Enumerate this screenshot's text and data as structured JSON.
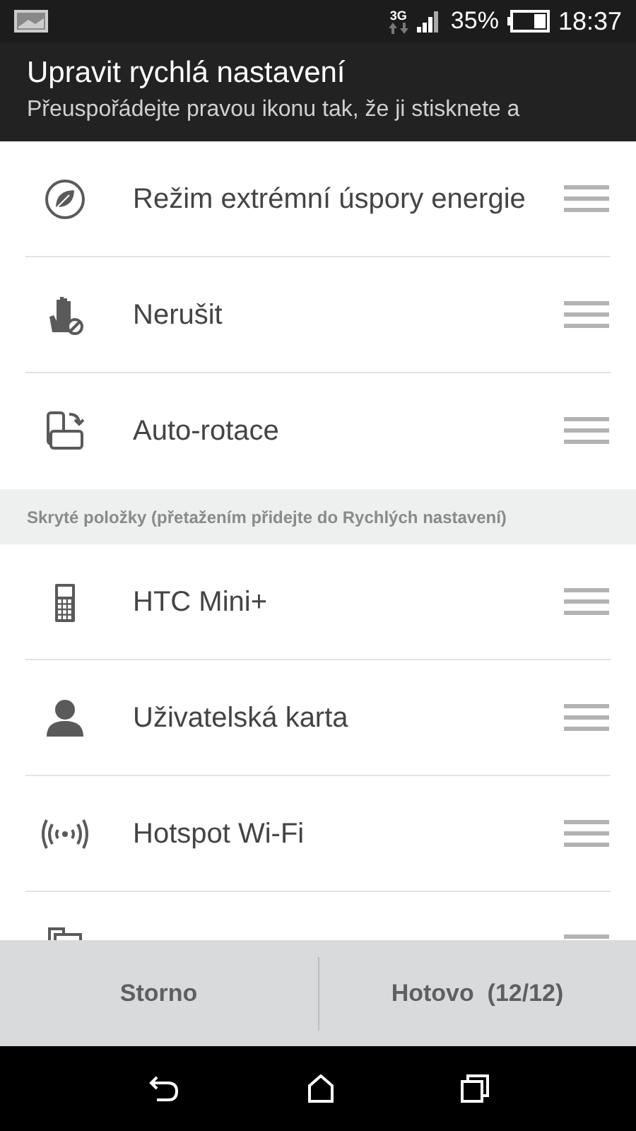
{
  "status_bar": {
    "network": "3G",
    "battery": "35%",
    "time": "18:37"
  },
  "header": {
    "title": "Upravit rychlá nastavení",
    "subtitle": "Přeuspořádejte pravou ikonu tak, že ji stisknete a"
  },
  "active_items": [
    {
      "label": "Režim extrémní úspory energie"
    },
    {
      "label": "Nerušit"
    },
    {
      "label": "Auto-rotace"
    }
  ],
  "hidden_section": {
    "title": "Skryté položky (přetažením přidejte do Rychlých nastavení)"
  },
  "hidden_items": [
    {
      "kind": "setting",
      "label": "HTC Mini+"
    },
    {
      "kind": "setting",
      "label": "Uživatelská karta"
    },
    {
      "kind": "setting",
      "label": "Hotspot Wi-Fi"
    },
    {
      "kind": "clipped"
    }
  ],
  "buttons": [
    {
      "label": "Storno"
    },
    {
      "label": "Hotovo  (12/12)"
    }
  ]
}
